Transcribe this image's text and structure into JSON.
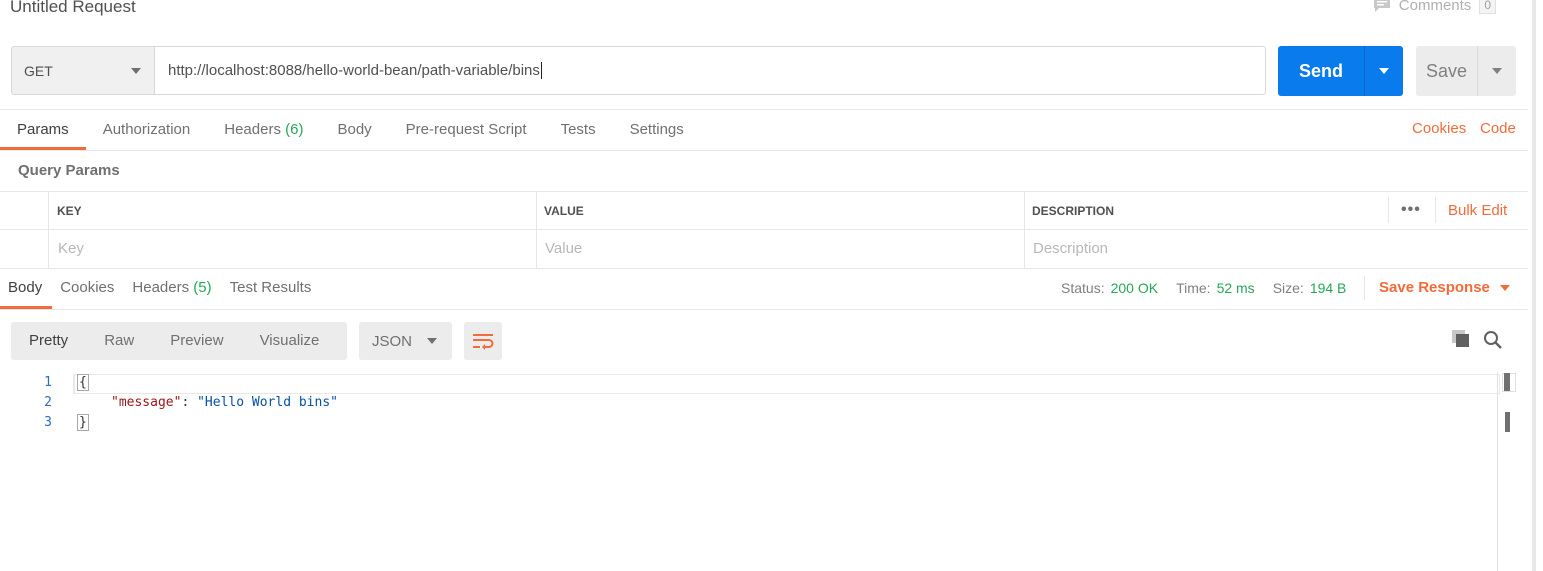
{
  "header": {
    "title": "Untitled Request",
    "comments_label": "Comments",
    "comments_count": "0"
  },
  "request": {
    "method": "GET",
    "url": "http://localhost:8088/hello-world-bean/path-variable/bins",
    "send_label": "Send",
    "save_label": "Save"
  },
  "request_tabs": [
    {
      "label": "Params",
      "count": ""
    },
    {
      "label": "Authorization",
      "count": ""
    },
    {
      "label": "Headers",
      "count": "(6)"
    },
    {
      "label": "Body",
      "count": ""
    },
    {
      "label": "Pre-request Script",
      "count": ""
    },
    {
      "label": "Tests",
      "count": ""
    },
    {
      "label": "Settings",
      "count": ""
    }
  ],
  "links": {
    "cookies": "Cookies",
    "code": "Code",
    "bulk_edit": "Bulk Edit"
  },
  "query_params": {
    "title": "Query Params",
    "columns": [
      "KEY",
      "VALUE",
      "DESCRIPTION"
    ],
    "placeholders": [
      "Key",
      "Value",
      "Description"
    ]
  },
  "response_tabs": [
    {
      "label": "Body",
      "count": ""
    },
    {
      "label": "Cookies",
      "count": ""
    },
    {
      "label": "Headers",
      "count": "(5)"
    },
    {
      "label": "Test Results",
      "count": ""
    }
  ],
  "response_status": {
    "status_label": "Status:",
    "status_value": "200 OK",
    "time_label": "Time:",
    "time_value": "52 ms",
    "size_label": "Size:",
    "size_value": "194 B",
    "save_response": "Save Response"
  },
  "body_view": {
    "modes": [
      "Pretty",
      "Raw",
      "Preview",
      "Visualize"
    ],
    "format": "JSON"
  },
  "code": {
    "line_numbers": [
      "1",
      "2",
      "3"
    ],
    "open_brace": "{",
    "key": "\"message\"",
    "colon": ": ",
    "value": "\"Hello World bins\"",
    "close_brace": "}"
  },
  "colors": {
    "accent": "#f26b3a",
    "send_blue": "#097bed",
    "success_green": "#26a65b"
  }
}
